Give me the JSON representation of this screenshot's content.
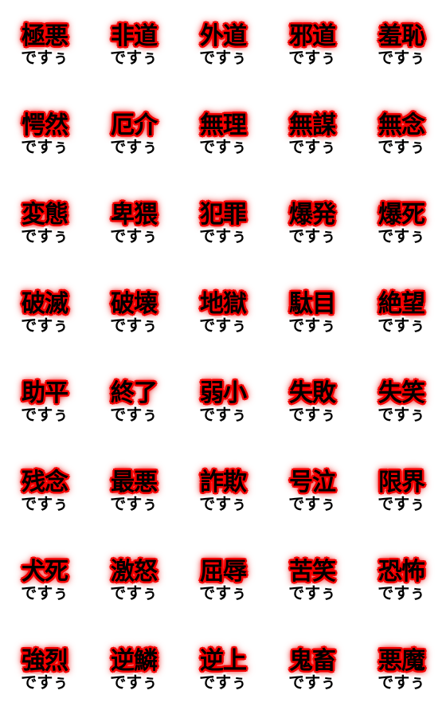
{
  "sheet": {
    "background_color": "#ffffff",
    "columns": 5,
    "rows": 8,
    "kanji_color": "#000000",
    "kanji_glow_color": "#ee0000",
    "suffix_color": "#000000",
    "suffix_outline_color": "#ffffff",
    "common_suffix": "ですぅ"
  },
  "stickers": [
    {
      "kanji": "極悪",
      "suffix": "ですぅ"
    },
    {
      "kanji": "非道",
      "suffix": "ですぅ"
    },
    {
      "kanji": "外道",
      "suffix": "ですぅ"
    },
    {
      "kanji": "邪道",
      "suffix": "ですぅ"
    },
    {
      "kanji": "羞恥",
      "suffix": "ですぅ"
    },
    {
      "kanji": "愕然",
      "suffix": "ですぅ"
    },
    {
      "kanji": "厄介",
      "suffix": "ですぅ"
    },
    {
      "kanji": "無理",
      "suffix": "ですぅ"
    },
    {
      "kanji": "無謀",
      "suffix": "ですぅ"
    },
    {
      "kanji": "無念",
      "suffix": "ですぅ"
    },
    {
      "kanji": "変態",
      "suffix": "ですぅ"
    },
    {
      "kanji": "卑猥",
      "suffix": "ですぅ"
    },
    {
      "kanji": "犯罪",
      "suffix": "ですぅ"
    },
    {
      "kanji": "爆発",
      "suffix": "ですぅ"
    },
    {
      "kanji": "爆死",
      "suffix": "ですぅ"
    },
    {
      "kanji": "破滅",
      "suffix": "ですぅ"
    },
    {
      "kanji": "破壊",
      "suffix": "ですぅ"
    },
    {
      "kanji": "地獄",
      "suffix": "ですぅ"
    },
    {
      "kanji": "駄目",
      "suffix": "ですぅ"
    },
    {
      "kanji": "絶望",
      "suffix": "ですぅ"
    },
    {
      "kanji": "助平",
      "suffix": "ですぅ"
    },
    {
      "kanji": "終了",
      "suffix": "ですぅ"
    },
    {
      "kanji": "弱小",
      "suffix": "ですぅ"
    },
    {
      "kanji": "失敗",
      "suffix": "ですぅ"
    },
    {
      "kanji": "失笑",
      "suffix": "ですぅ"
    },
    {
      "kanji": "残念",
      "suffix": "ですぅ"
    },
    {
      "kanji": "最悪",
      "suffix": "ですぅ"
    },
    {
      "kanji": "詐欺",
      "suffix": "ですぅ"
    },
    {
      "kanji": "号泣",
      "suffix": "ですぅ"
    },
    {
      "kanji": "限界",
      "suffix": "ですぅ"
    },
    {
      "kanji": "犬死",
      "suffix": "ですぅ"
    },
    {
      "kanji": "激怒",
      "suffix": "ですぅ"
    },
    {
      "kanji": "屈辱",
      "suffix": "ですぅ"
    },
    {
      "kanji": "苦笑",
      "suffix": "ですぅ"
    },
    {
      "kanji": "恐怖",
      "suffix": "ですぅ"
    },
    {
      "kanji": "強烈",
      "suffix": "ですぅ"
    },
    {
      "kanji": "逆鱗",
      "suffix": "ですぅ"
    },
    {
      "kanji": "逆上",
      "suffix": "ですぅ"
    },
    {
      "kanji": "鬼畜",
      "suffix": "ですぅ"
    },
    {
      "kanji": "悪魔",
      "suffix": "ですぅ"
    }
  ]
}
